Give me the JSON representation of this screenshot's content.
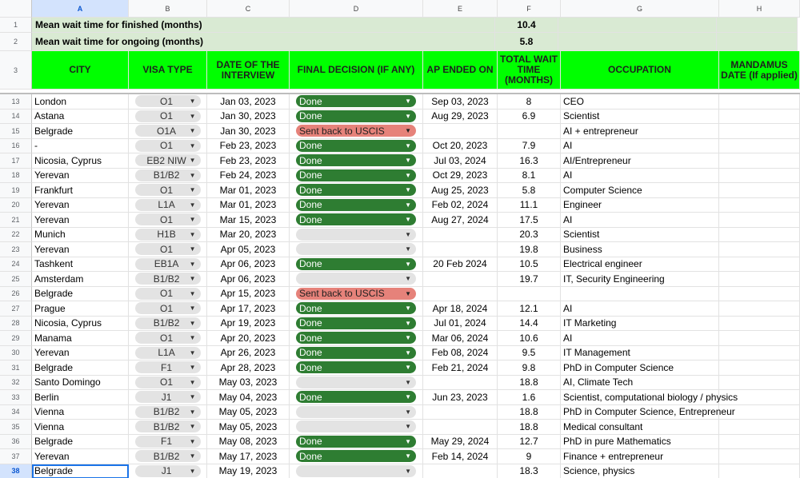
{
  "columns": [
    "A",
    "B",
    "C",
    "D",
    "E",
    "F",
    "G",
    "H"
  ],
  "summary": [
    {
      "row": "1",
      "label": "Mean wait time for finished (months)",
      "value": "10.4"
    },
    {
      "row": "2",
      "label": "Mean wait time for ongoing (months)",
      "value": "5.8"
    }
  ],
  "header_row": "3",
  "headers": [
    "CITY",
    "VISA TYPE",
    "DATE OF THE INTERVIEW",
    "FINAL DECISION (IF ANY)",
    "AP ENDED ON",
    "TOTAL WAIT TIME (MONTHS)",
    "OCCUPATION",
    "MANDAMUS DATE (If applied)"
  ],
  "rows": [
    {
      "n": "13",
      "city": "London",
      "visa": "O1",
      "date": "Jan 03, 2023",
      "decision": "Done",
      "ap": "Sep 03, 2023",
      "wait": "8",
      "occ": "CEO"
    },
    {
      "n": "14",
      "city": "Astana",
      "visa": "O1",
      "date": "Jan 30, 2023",
      "decision": "Done",
      "ap": "Aug 29, 2023",
      "wait": "6.9",
      "occ": "Scientist"
    },
    {
      "n": "15",
      "city": "Belgrade",
      "visa": "O1A",
      "date": "Jan 30, 2023",
      "decision": "Sent back to USCIS",
      "ap": "",
      "wait": "",
      "occ": "AI + entrepreneur"
    },
    {
      "n": "16",
      "city": "-",
      "visa": "O1",
      "date": "Feb 23, 2023",
      "decision": "Done",
      "ap": "Oct 20, 2023",
      "wait": "7.9",
      "occ": "AI"
    },
    {
      "n": "17",
      "city": "Nicosia, Cyprus",
      "visa": "EB2 NIW",
      "date": "Feb 23, 2023",
      "decision": "Done",
      "ap": "Jul 03, 2024",
      "wait": "16.3",
      "occ": "AI/Entrepreneur"
    },
    {
      "n": "18",
      "city": "Yerevan",
      "visa": "B1/B2",
      "date": "Feb 24, 2023",
      "decision": "Done",
      "ap": "Oct 29, 2023",
      "wait": "8.1",
      "occ": "AI"
    },
    {
      "n": "19",
      "city": "Frankfurt",
      "visa": "O1",
      "date": "Mar 01, 2023",
      "decision": "Done",
      "ap": "Aug 25, 2023",
      "wait": "5.8",
      "occ": "Computer Science"
    },
    {
      "n": "20",
      "city": "Yerevan",
      "visa": "L1A",
      "date": "Mar 01, 2023",
      "decision": "Done",
      "ap": "Feb 02, 2024",
      "wait": "11.1",
      "occ": "Engineer"
    },
    {
      "n": "21",
      "city": "Yerevan",
      "visa": "O1",
      "date": "Mar 15, 2023",
      "decision": "Done",
      "ap": "Aug 27, 2024",
      "wait": "17.5",
      "occ": "AI"
    },
    {
      "n": "22",
      "city": "Munich",
      "visa": "H1B",
      "date": "Mar 20, 2023",
      "decision": "",
      "ap": "",
      "wait": "20.3",
      "occ": "Scientist"
    },
    {
      "n": "23",
      "city": "Yerevan",
      "visa": "O1",
      "date": "Apr 05, 2023",
      "decision": "",
      "ap": "",
      "wait": "19.8",
      "occ": "Business"
    },
    {
      "n": "24",
      "city": "Tashkent",
      "visa": "EB1A",
      "date": "Apr 06, 2023",
      "decision": "Done",
      "ap": "20 Feb 2024",
      "wait": "10.5",
      "occ": "Electrical engineer"
    },
    {
      "n": "25",
      "city": "Amsterdam",
      "visa": "B1/B2",
      "date": "Apr 06, 2023",
      "decision": "",
      "ap": "",
      "wait": "19.7",
      "occ": "IT, Security Engineering"
    },
    {
      "n": "26",
      "city": "Belgrade",
      "visa": "O1",
      "date": "Apr 15, 2023",
      "decision": "Sent back to USCIS",
      "ap": "",
      "wait": "",
      "occ": ""
    },
    {
      "n": "27",
      "city": "Prague",
      "visa": "O1",
      "date": "Apr 17, 2023",
      "decision": "Done",
      "ap": "Apr 18, 2024",
      "wait": "12.1",
      "occ": "AI"
    },
    {
      "n": "28",
      "city": "Nicosia, Cyprus",
      "visa": "B1/B2",
      "date": "Apr 19, 2023",
      "decision": "Done",
      "ap": "Jul 01, 2024",
      "wait": "14.4",
      "occ": "IT Marketing"
    },
    {
      "n": "29",
      "city": "Manama",
      "visa": "O1",
      "date": "Apr 20, 2023",
      "decision": "Done",
      "ap": "Mar 06, 2024",
      "wait": "10.6",
      "occ": "AI"
    },
    {
      "n": "30",
      "city": "Yerevan",
      "visa": "L1A",
      "date": "Apr 26, 2023",
      "decision": "Done",
      "ap": "Feb 08, 2024",
      "wait": "9.5",
      "occ": "IT Management"
    },
    {
      "n": "31",
      "city": "Belgrade",
      "visa": "F1",
      "date": "Apr 28, 2023",
      "decision": "Done",
      "ap": "Feb 21, 2024",
      "wait": "9.8",
      "occ": "PhD in Computer Science"
    },
    {
      "n": "32",
      "city": "Santo Domingo",
      "visa": "O1",
      "date": "May 03, 2023",
      "decision": "",
      "ap": "",
      "wait": "18.8",
      "occ": "AI, Climate Tech"
    },
    {
      "n": "33",
      "city": "Berlin",
      "visa": "J1",
      "date": "May 04, 2023",
      "decision": "Done",
      "ap": "Jun 23, 2023",
      "wait": "1.6",
      "occ": "Scientist, computational biology / physics"
    },
    {
      "n": "34",
      "city": "Vienna",
      "visa": "B1/B2",
      "date": "May 05, 2023",
      "decision": "",
      "ap": "",
      "wait": "18.8",
      "occ": "PhD in Computer Science, Entrepreneur"
    },
    {
      "n": "35",
      "city": "Vienna",
      "visa": "B1/B2",
      "date": "May 05, 2023",
      "decision": "",
      "ap": "",
      "wait": "18.8",
      "occ": "Medical consultant"
    },
    {
      "n": "36",
      "city": "Belgrade",
      "visa": "F1",
      "date": "May 08, 2023",
      "decision": "Done",
      "ap": "May 29, 2024",
      "wait": "12.7",
      "occ": "PhD in pure Mathematics"
    },
    {
      "n": "37",
      "city": "Yerevan",
      "visa": "B1/B2",
      "date": "May 17, 2023",
      "decision": "Done",
      "ap": "Feb 14, 2024",
      "wait": "9",
      "occ": "Finance + entrepreneur"
    },
    {
      "n": "38",
      "city": "Belgrade",
      "visa": "J1",
      "date": "May 19, 2023",
      "decision": "",
      "ap": "",
      "wait": "18.3",
      "occ": "Science, physics"
    }
  ],
  "colors": {
    "header_green": "#00ff00",
    "summary_green": "#d9ead3",
    "done_green": "#2e7d32",
    "sent_red": "#e6827a",
    "chip_gray": "#e3e3e3"
  }
}
